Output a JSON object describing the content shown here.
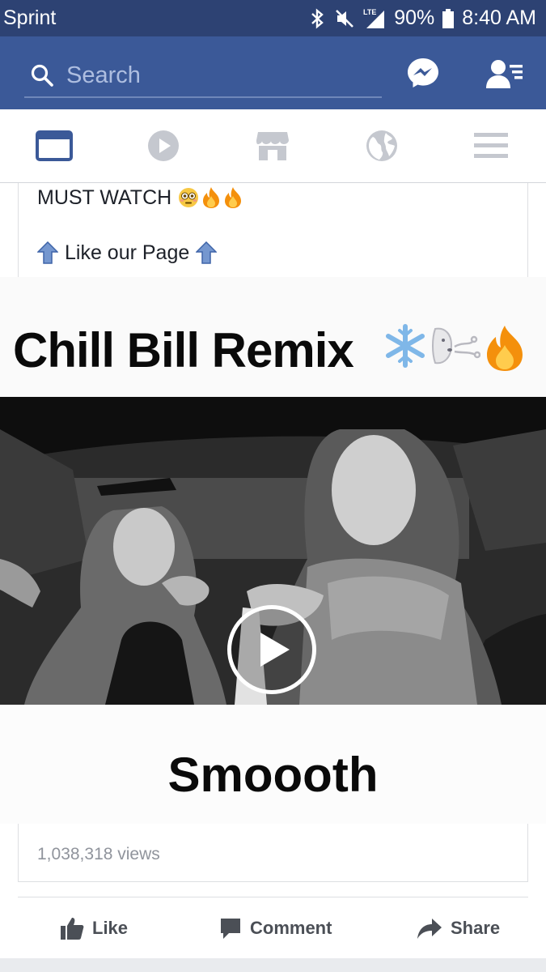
{
  "status_bar": {
    "carrier": "Sprint",
    "battery": "90%",
    "time": "8:40 AM",
    "network": "LTE"
  },
  "header": {
    "search_placeholder": "Search"
  },
  "tabs": [
    {
      "name": "news-feed",
      "active": true
    },
    {
      "name": "video"
    },
    {
      "name": "marketplace"
    },
    {
      "name": "notifications"
    },
    {
      "name": "menu"
    }
  ],
  "post": {
    "text_line1": "MUST WATCH",
    "text_line2": "Like our Page"
  },
  "video": {
    "title": "Chill Bill Remix",
    "caption": "Smoooth",
    "views": "1,038,318 views"
  },
  "actions": {
    "like": "Like",
    "comment": "Comment",
    "share": "Share"
  },
  "colors": {
    "brand": "#3b5998",
    "status_bar": "#2d4273",
    "active_tab": "#3b5998",
    "inactive_tab": "#c5c8cf"
  }
}
